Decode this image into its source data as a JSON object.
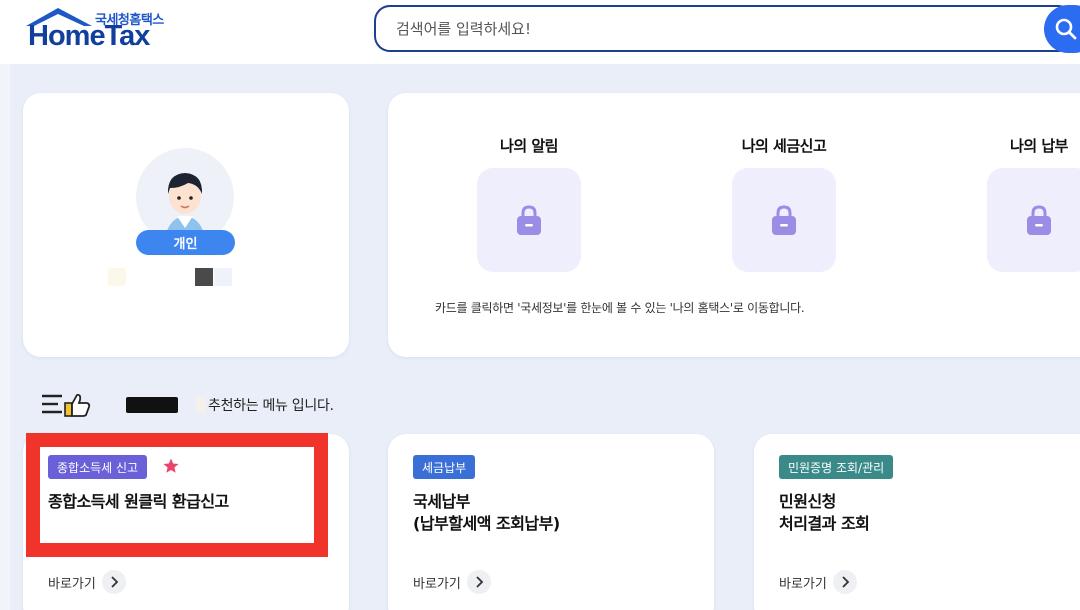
{
  "header": {
    "logo_sub": "국세청홈택스",
    "logo_main": "HomeTax",
    "search_placeholder": "검색어를 입력하세요!"
  },
  "profile": {
    "badge": "개인"
  },
  "my": {
    "items": [
      {
        "title": "나의 알림"
      },
      {
        "title": "나의 세금신고"
      },
      {
        "title": "나의 납부"
      }
    ],
    "note": "카드를 클릭하면 '국세정보'를 한눈에 볼 수 있는 '나의 홈택스'로 이동합니다."
  },
  "recommend": {
    "suffix": "추천하는 메뉴 입니다."
  },
  "menu_cards": [
    {
      "tag": "종합소득세 신고",
      "tag_color": "#6a61d8",
      "title": "종합소득세 원클릭 환급신고",
      "goto": "바로가기"
    },
    {
      "tag": "세금납부",
      "tag_color": "#3a6fd8",
      "title": "국세납부\n(납부할세액 조회납부)",
      "goto": "바로가기"
    },
    {
      "tag": "민원증명 조회/관리",
      "tag_color": "#3a8a8a",
      "title": "민원신청\n처리결과 조회",
      "goto": "바로가기"
    }
  ],
  "colors": {
    "accent": "#2b6cf0",
    "highlight": "#f0332b",
    "star": "#e8456b"
  }
}
